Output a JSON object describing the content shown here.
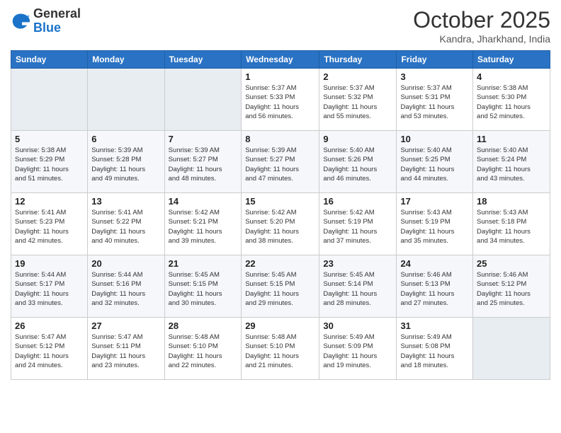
{
  "header": {
    "logo_general": "General",
    "logo_blue": "Blue",
    "month_year": "October 2025",
    "location": "Kandra, Jharkhand, India"
  },
  "days_of_week": [
    "Sunday",
    "Monday",
    "Tuesday",
    "Wednesday",
    "Thursday",
    "Friday",
    "Saturday"
  ],
  "weeks": [
    [
      {
        "day": "",
        "info": ""
      },
      {
        "day": "",
        "info": ""
      },
      {
        "day": "",
        "info": ""
      },
      {
        "day": "1",
        "info": "Sunrise: 5:37 AM\nSunset: 5:33 PM\nDaylight: 11 hours\nand 56 minutes."
      },
      {
        "day": "2",
        "info": "Sunrise: 5:37 AM\nSunset: 5:32 PM\nDaylight: 11 hours\nand 55 minutes."
      },
      {
        "day": "3",
        "info": "Sunrise: 5:37 AM\nSunset: 5:31 PM\nDaylight: 11 hours\nand 53 minutes."
      },
      {
        "day": "4",
        "info": "Sunrise: 5:38 AM\nSunset: 5:30 PM\nDaylight: 11 hours\nand 52 minutes."
      }
    ],
    [
      {
        "day": "5",
        "info": "Sunrise: 5:38 AM\nSunset: 5:29 PM\nDaylight: 11 hours\nand 51 minutes."
      },
      {
        "day": "6",
        "info": "Sunrise: 5:39 AM\nSunset: 5:28 PM\nDaylight: 11 hours\nand 49 minutes."
      },
      {
        "day": "7",
        "info": "Sunrise: 5:39 AM\nSunset: 5:27 PM\nDaylight: 11 hours\nand 48 minutes."
      },
      {
        "day": "8",
        "info": "Sunrise: 5:39 AM\nSunset: 5:27 PM\nDaylight: 11 hours\nand 47 minutes."
      },
      {
        "day": "9",
        "info": "Sunrise: 5:40 AM\nSunset: 5:26 PM\nDaylight: 11 hours\nand 46 minutes."
      },
      {
        "day": "10",
        "info": "Sunrise: 5:40 AM\nSunset: 5:25 PM\nDaylight: 11 hours\nand 44 minutes."
      },
      {
        "day": "11",
        "info": "Sunrise: 5:40 AM\nSunset: 5:24 PM\nDaylight: 11 hours\nand 43 minutes."
      }
    ],
    [
      {
        "day": "12",
        "info": "Sunrise: 5:41 AM\nSunset: 5:23 PM\nDaylight: 11 hours\nand 42 minutes."
      },
      {
        "day": "13",
        "info": "Sunrise: 5:41 AM\nSunset: 5:22 PM\nDaylight: 11 hours\nand 40 minutes."
      },
      {
        "day": "14",
        "info": "Sunrise: 5:42 AM\nSunset: 5:21 PM\nDaylight: 11 hours\nand 39 minutes."
      },
      {
        "day": "15",
        "info": "Sunrise: 5:42 AM\nSunset: 5:20 PM\nDaylight: 11 hours\nand 38 minutes."
      },
      {
        "day": "16",
        "info": "Sunrise: 5:42 AM\nSunset: 5:19 PM\nDaylight: 11 hours\nand 37 minutes."
      },
      {
        "day": "17",
        "info": "Sunrise: 5:43 AM\nSunset: 5:19 PM\nDaylight: 11 hours\nand 35 minutes."
      },
      {
        "day": "18",
        "info": "Sunrise: 5:43 AM\nSunset: 5:18 PM\nDaylight: 11 hours\nand 34 minutes."
      }
    ],
    [
      {
        "day": "19",
        "info": "Sunrise: 5:44 AM\nSunset: 5:17 PM\nDaylight: 11 hours\nand 33 minutes."
      },
      {
        "day": "20",
        "info": "Sunrise: 5:44 AM\nSunset: 5:16 PM\nDaylight: 11 hours\nand 32 minutes."
      },
      {
        "day": "21",
        "info": "Sunrise: 5:45 AM\nSunset: 5:15 PM\nDaylight: 11 hours\nand 30 minutes."
      },
      {
        "day": "22",
        "info": "Sunrise: 5:45 AM\nSunset: 5:15 PM\nDaylight: 11 hours\nand 29 minutes."
      },
      {
        "day": "23",
        "info": "Sunrise: 5:45 AM\nSunset: 5:14 PM\nDaylight: 11 hours\nand 28 minutes."
      },
      {
        "day": "24",
        "info": "Sunrise: 5:46 AM\nSunset: 5:13 PM\nDaylight: 11 hours\nand 27 minutes."
      },
      {
        "day": "25",
        "info": "Sunrise: 5:46 AM\nSunset: 5:12 PM\nDaylight: 11 hours\nand 25 minutes."
      }
    ],
    [
      {
        "day": "26",
        "info": "Sunrise: 5:47 AM\nSunset: 5:12 PM\nDaylight: 11 hours\nand 24 minutes."
      },
      {
        "day": "27",
        "info": "Sunrise: 5:47 AM\nSunset: 5:11 PM\nDaylight: 11 hours\nand 23 minutes."
      },
      {
        "day": "28",
        "info": "Sunrise: 5:48 AM\nSunset: 5:10 PM\nDaylight: 11 hours\nand 22 minutes."
      },
      {
        "day": "29",
        "info": "Sunrise: 5:48 AM\nSunset: 5:10 PM\nDaylight: 11 hours\nand 21 minutes."
      },
      {
        "day": "30",
        "info": "Sunrise: 5:49 AM\nSunset: 5:09 PM\nDaylight: 11 hours\nand 19 minutes."
      },
      {
        "day": "31",
        "info": "Sunrise: 5:49 AM\nSunset: 5:08 PM\nDaylight: 11 hours\nand 18 minutes."
      },
      {
        "day": "",
        "info": ""
      }
    ]
  ]
}
